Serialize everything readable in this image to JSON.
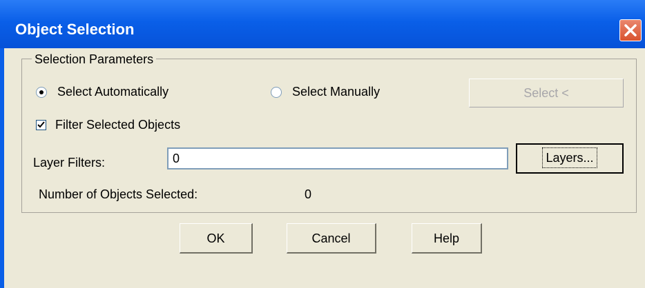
{
  "window": {
    "title": "Object Selection"
  },
  "group": {
    "legend": "Selection Parameters"
  },
  "options": {
    "select_auto_label": "Select Automatically",
    "select_manual_label": "Select Manually",
    "filter_label": "Filter Selected Objects"
  },
  "buttons": {
    "select": "Select <",
    "layers": "Layers...",
    "ok": "OK",
    "cancel": "Cancel",
    "help": "Help"
  },
  "layer_filters": {
    "label": "Layer Filters:",
    "value": "0"
  },
  "count": {
    "label": "Number of Objects Selected:",
    "value": "0"
  }
}
